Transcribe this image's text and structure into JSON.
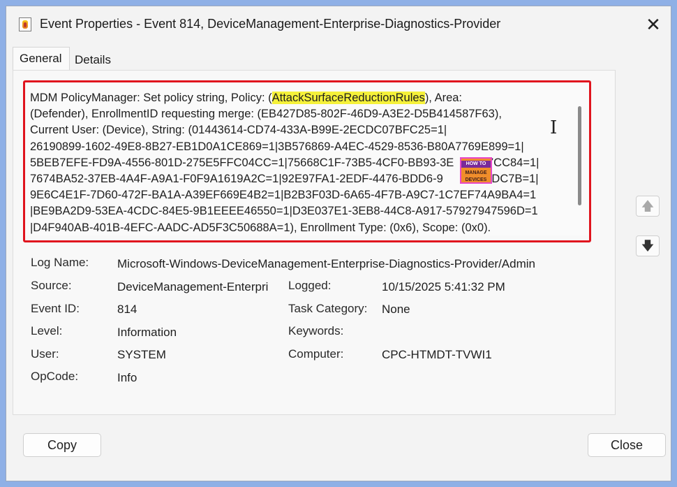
{
  "window": {
    "title": "Event Properties - Event 814, DeviceManagement-Enterprise-Diagnostics-Provider",
    "close_icon": "close-icon"
  },
  "tabs": [
    {
      "label": "General",
      "active": true
    },
    {
      "label": "Details",
      "active": false
    }
  ],
  "message": {
    "prefix": "MDM PolicyManager: Set policy string, Policy: (",
    "highlight": "AttackSurfaceReductionRules",
    "line1_suffix": "), Area:",
    "lines": [
      "(Defender), EnrollmentID requesting merge: (EB427D85-802F-46D9-A3E2-D5B414587F63),",
      "Current User: (Device), String: (01443614-CD74-433A-B99E-2ECDC07BFC25=1|",
      "26190899-1602-49E8-8B27-EB1D0A1CE869=1|3B576869-A4EC-4529-8536-B80A7769E899=1|",
      "5BEB7EFE-FD9A-4556-801D-275E5FFC04CC=1|75668C1F-73B5-4CF0-BB93-3E        B7CC84=1|",
      "7674BA52-37EB-4A4F-A9A1-F0F9A1619A2C=1|92E97FA1-2EDF-4476-BDD6-9        4DDDC7B=1|",
      "9E6C4E1F-7D60-472F-BA1A-A39EF669E4B2=1|B2B3F03D-6A65-4F7B-A9C7-1C7EF74A9BA4=1",
      "|BE9BA2D9-53EA-4CDC-84E5-9B1EEEE46550=1|D3E037E1-3EB8-44C8-A917-57927947596D=1",
      "|D4F940AB-401B-4EFC-AADC-AD5F3C50688A=1), Enrollment Type: (0x6), Scope: (0x0)."
    ],
    "watermark_top": "HOW TO",
    "watermark_bottom": "MANAGE DEVICES"
  },
  "details": {
    "log_name_label": "Log Name:",
    "log_name": "Microsoft-Windows-DeviceManagement-Enterprise-Diagnostics-Provider/Admin",
    "source_label": "Source:",
    "source": "DeviceManagement-Enterpri",
    "logged_label": "Logged:",
    "logged": "10/15/2025 5:41:32 PM",
    "event_id_label": "Event ID:",
    "event_id": "814",
    "task_category_label": "Task Category:",
    "task_category": "None",
    "level_label": "Level:",
    "level": "Information",
    "keywords_label": "Keywords:",
    "keywords": "",
    "user_label": "User:",
    "user": "SYSTEM",
    "computer_label": "Computer:",
    "computer": "CPC-HTMDT-TVWI1",
    "opcode_label": "OpCode:",
    "opcode": "Info"
  },
  "buttons": {
    "copy": "Copy",
    "close": "Close",
    "up_icon": "arrow-up-icon",
    "down_icon": "arrow-down-icon"
  },
  "colors": {
    "highlight": "#f5f13a",
    "annotation_frame": "#e0141e",
    "background": "#8fb0e6"
  }
}
